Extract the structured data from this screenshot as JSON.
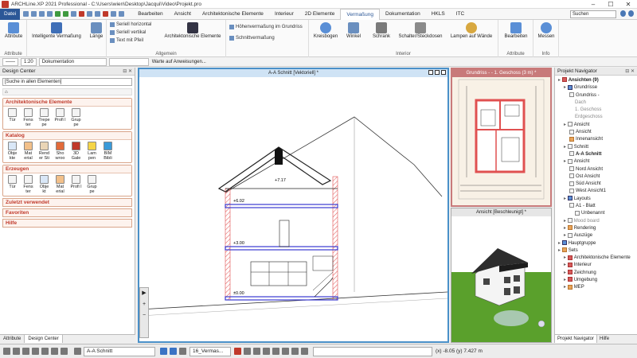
{
  "window": {
    "title": "ARCHLine.XP 2021  Professional - C:\\Users\\wien\\Desktop\\Jacqui\\Video\\Projekt.pro"
  },
  "menu": {
    "file": "Datei",
    "tabs": [
      "Bearbeiten",
      "Ansicht",
      "Architektonische Elemente",
      "Interieur",
      "2D Elemente",
      "Vermaßung",
      "Dokumentation",
      "HKLS",
      "ITC"
    ],
    "active_tab": "Vermaßung",
    "search_placeholder": "Suchen"
  },
  "ribbon": {
    "groups": [
      {
        "label": "Attribute",
        "buttons": [
          "Attribute"
        ]
      },
      {
        "label": "",
        "buttons": [
          "Intelligente Vermaßung",
          "Länge"
        ]
      },
      {
        "label": "Allgemein",
        "small": [
          "Seriell horizontal",
          "Seriell vertikal",
          "Text mit Pfeil"
        ],
        "buttons": [
          "Architektonische Elemente"
        ]
      },
      {
        "label": "",
        "small": [
          "Höhenvermaßung im Grundriss",
          "Schnittvermaßung"
        ]
      },
      {
        "label": "Interior",
        "buttons": [
          "Kreisbogen",
          "Winkel",
          "Schrank",
          "Schalter/Steckdosen",
          "Lampen auf Wände"
        ]
      },
      {
        "label": "Attribute",
        "buttons": [
          "Bearbeiten"
        ]
      },
      {
        "label": "Info",
        "buttons": [
          "Messen"
        ]
      }
    ]
  },
  "toolstrip": {
    "scale": "1:20",
    "layer": "Dokumentation",
    "prompt": "Warte auf Anweisungen..."
  },
  "design_center": {
    "title": "Design Center",
    "search_placeholder": "[Suche in allen Elementen]",
    "sections": [
      {
        "title": "Architektonische Elemente",
        "items": [
          "Tür",
          "Fens ter",
          "Trepe pe",
          "Profi l",
          "Grup pe"
        ]
      },
      {
        "title": "Katalog",
        "items": [
          "Obje kte",
          "Mat erial",
          "Rend er Sti",
          "Sho wroo",
          "3D Gale",
          "Lam pen",
          "BIM Bibli"
        ]
      },
      {
        "title": "Erzeugen",
        "items": [
          "Tür",
          "Fens ter",
          "Obje kt",
          "Mat erial",
          "Profi l",
          "Grup pe"
        ]
      }
    ],
    "collapsed": [
      "Zuletzt verwendet",
      "Favoriten",
      "Hilfe"
    ],
    "bottom_tabs": [
      "Attribute",
      "Design Center"
    ],
    "active_bottom_tab": "Design Center"
  },
  "views": {
    "section": {
      "title": "A-A Schnitt [Vektoriell] *",
      "labels": [
        "+7.17",
        "+6.02",
        "+3.00",
        "±0.00"
      ]
    },
    "plan": {
      "title": "Grundriss - - 1. Geschoss (3 m) *"
    },
    "threed": {
      "title": "Ansicht [Beschleunigt] *"
    }
  },
  "navigator": {
    "title": "Projekt Navigator",
    "tree": [
      {
        "text": "Ansichten (9)",
        "level": 0,
        "bold": true,
        "icon": "red"
      },
      {
        "text": "Grundrisse",
        "level": 1,
        "icon": "blue"
      },
      {
        "text": "Grundriss -",
        "level": 2,
        "icon": "none"
      },
      {
        "text": "Dach",
        "level": 3,
        "icon": "",
        "grey": true
      },
      {
        "text": "1. Geschoss",
        "level": 3,
        "icon": "",
        "grey": true
      },
      {
        "text": "Erdgeschoss",
        "level": 3,
        "icon": "",
        "grey": true
      },
      {
        "text": "Ansicht",
        "level": 1,
        "icon": "none"
      },
      {
        "text": "Ansicht",
        "level": 2,
        "icon": "none"
      },
      {
        "text": "Innenansicht",
        "level": 2,
        "icon": "orange"
      },
      {
        "text": "Schnitt",
        "level": 1,
        "icon": "none"
      },
      {
        "text": "A-A Schnitt",
        "level": 2,
        "icon": "none",
        "bold": true
      },
      {
        "text": "Ansicht",
        "level": 1,
        "icon": "none"
      },
      {
        "text": "Nord Ansicht",
        "level": 2,
        "icon": "none"
      },
      {
        "text": "Ost Ansicht",
        "level": 2,
        "icon": "none"
      },
      {
        "text": "Süd Ansicht",
        "level": 2,
        "icon": "none"
      },
      {
        "text": "West Ansicht1",
        "level": 2,
        "icon": "none"
      },
      {
        "text": "Layouts",
        "level": 1,
        "icon": "blue"
      },
      {
        "text": "A1 - Blatt",
        "level": 2,
        "icon": "none"
      },
      {
        "text": "Unbenannt",
        "level": 3,
        "icon": "none"
      },
      {
        "text": "Mood board",
        "level": 1,
        "icon": "none",
        "grey": true
      },
      {
        "text": "Rendering",
        "level": 1,
        "icon": "orange"
      },
      {
        "text": "Auszüge",
        "level": 1,
        "icon": "none"
      },
      {
        "text": "Hauptgruppe",
        "level": 0,
        "icon": "blue"
      },
      {
        "text": "Sets",
        "level": 0,
        "icon": "orange"
      },
      {
        "text": "Architektonische Elemente",
        "level": 1,
        "icon": "red"
      },
      {
        "text": "Interieur",
        "level": 1,
        "icon": "red"
      },
      {
        "text": "Zeichnung",
        "level": 1,
        "icon": "red"
      },
      {
        "text": "Umgebung",
        "level": 1,
        "icon": "red"
      },
      {
        "text": "MEP",
        "level": 1,
        "icon": "orange"
      }
    ],
    "bottom_tabs": [
      "Projekt Navigator",
      "Hilfe"
    ],
    "active_bottom_tab": "Projekt Navigator"
  },
  "statusbar": {
    "view_name": "A-A Schnitt",
    "layer_name": "16_Vermas...",
    "coords": "(x) -8.05  (y) 7.427 m"
  },
  "colors": {
    "accent": "#2b5797",
    "active_border": "#4a90c8",
    "plan_border": "#c87a7a",
    "hatch_red": "#e05050",
    "slab_blue": "#3a3ad0"
  }
}
